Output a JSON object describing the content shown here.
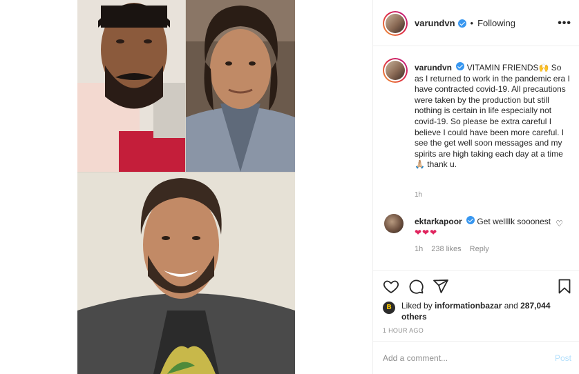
{
  "header": {
    "username": "varundvn",
    "separator": "•",
    "follow_status": "Following",
    "more_label": "•••"
  },
  "caption": {
    "username": "varundvn",
    "text": "VITAMIN FRIENDS🙌 So as I returned to work in the pandemic era I have contracted covid-19. All precautions were taken by the production but still nothing is certain in life especially not covid-19. So please be extra careful I believe I could have been more careful. I see the get well soon messages and my spirits are high taking each day at a time 🙏🏼 thank u.",
    "time": "1h"
  },
  "comments": [
    {
      "username": "ektarkapoor",
      "text": "Get wellllk sooonest",
      "hearts": "❤❤❤",
      "time": "1h",
      "likes": "238 likes",
      "reply": "Reply"
    }
  ],
  "actions": {
    "like_icon": "heart-icon",
    "comment_icon": "comment-icon",
    "share_icon": "share-icon",
    "save_icon": "bookmark-icon"
  },
  "likes": {
    "prefix": "Liked by",
    "user": "informationbazar",
    "and": "and",
    "count": "287,044 others"
  },
  "post_time": "1 HOUR AGO",
  "add_comment": {
    "placeholder": "Add a comment...",
    "post_label": "Post"
  },
  "colors": {
    "verified": "#3897f0",
    "heart": "#e0245e",
    "post_disabled": "#b2dffc",
    "muted": "#8e8e8e"
  }
}
